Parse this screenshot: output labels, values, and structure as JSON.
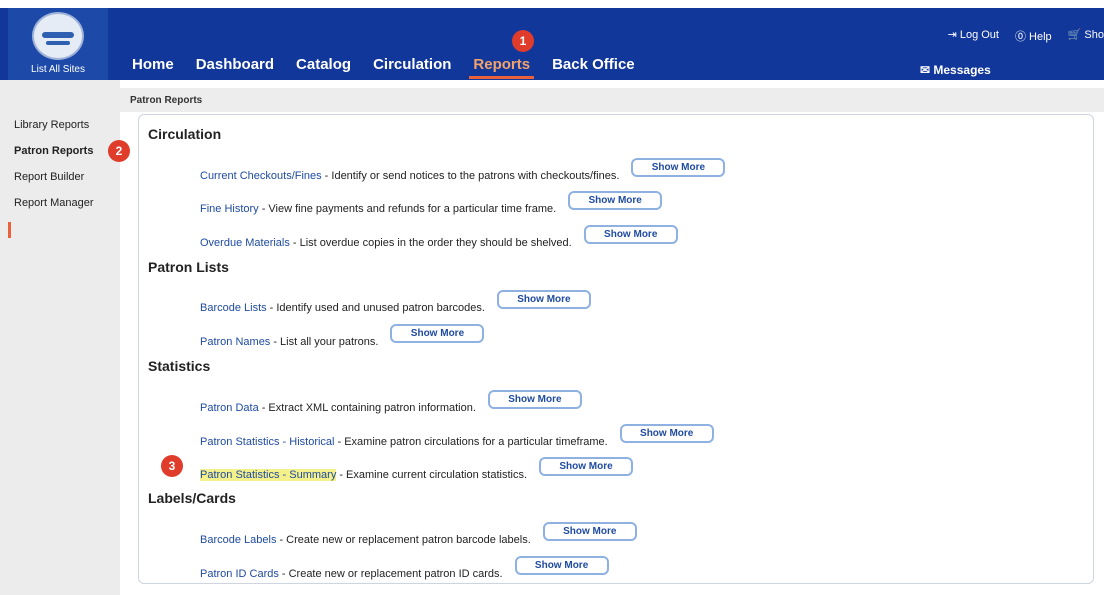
{
  "header": {
    "site_link": "List All Sites",
    "nav": [
      "Home",
      "Dashboard",
      "Catalog",
      "Circulation",
      "Reports",
      "Back Office"
    ],
    "actions": [
      "⇥ Log Out",
      "⓪ Help",
      "🛒 Sho"
    ],
    "messages": "✉  Messages"
  },
  "sidebar": {
    "items": [
      "Library Reports",
      "Patron Reports",
      "Report Builder",
      "Report Manager"
    ]
  },
  "breadcrumb": "Patron Reports",
  "badges": [
    "1",
    "2",
    "3"
  ],
  "sections": [
    {
      "title": "Circulation",
      "rows": [
        {
          "link": "Current Checkouts/Fines",
          "desc": "- Identify or send notices to the patrons with checkouts/fines."
        },
        {
          "link": "Fine History",
          "desc": "- View fine payments and refunds for a particular time frame."
        },
        {
          "link": "Overdue Materials",
          "desc": "- List overdue copies in the order they should be shelved."
        }
      ]
    },
    {
      "title": "Patron Lists",
      "rows": [
        {
          "link": "Barcode Lists",
          "desc": "- Identify used and unused patron barcodes."
        },
        {
          "link": "Patron Names",
          "desc": "- List all your patrons."
        }
      ]
    },
    {
      "title": "Statistics",
      "rows": [
        {
          "link": "Patron Data",
          "desc": "- Extract XML containing patron information."
        },
        {
          "link": "Patron Statistics - Historical",
          "desc": "- Examine patron circulations for a particular timeframe."
        },
        {
          "link": "Patron Statistics - Summary",
          "desc": "- Examine current circulation statistics."
        }
      ]
    },
    {
      "title": "Labels/Cards",
      "rows": [
        {
          "link": "Barcode Labels",
          "desc": "- Create new or replacement patron barcode labels."
        },
        {
          "link": "Patron ID Cards",
          "desc": "- Create new or replacement patron ID cards."
        }
      ]
    }
  ],
  "show_more_label": "Show More",
  "colors": {
    "header": "#12379a",
    "active": "#e8623b",
    "link": "#1f4ba0",
    "badge": "#e03c2c",
    "highlight": "#f4f08a"
  }
}
